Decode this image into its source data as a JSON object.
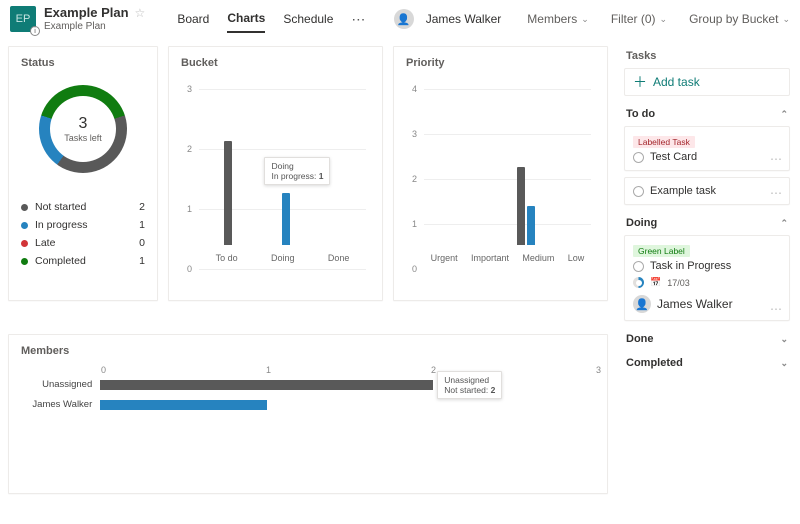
{
  "header": {
    "plan_initials": "EP",
    "plan_title": "Example Plan",
    "plan_subtitle": "Example Plan",
    "tabs": {
      "board": "Board",
      "charts": "Charts",
      "schedule": "Schedule"
    },
    "user": "James Walker",
    "members_cmd": "Members",
    "filter_cmd": "Filter (0)",
    "group_cmd": "Group by Bucket"
  },
  "chart_data": {
    "status": {
      "type": "donut",
      "center_value": 3,
      "center_label": "Tasks left",
      "legend": [
        {
          "label": "Not started",
          "value": 2,
          "color": "#595959"
        },
        {
          "label": "In progress",
          "value": 1,
          "color": "#2683bf"
        },
        {
          "label": "Late",
          "value": 0,
          "color": "#d13438"
        },
        {
          "label": "Completed",
          "value": 1,
          "color": "#107c10"
        }
      ]
    },
    "bucket": {
      "type": "bar",
      "title": "Bucket",
      "categories": [
        "To do",
        "Doing",
        "Done"
      ],
      "yticks": [
        0,
        1,
        2,
        3
      ],
      "ylim": [
        0,
        3
      ],
      "series": [
        {
          "name": "Not started",
          "color": "#595959",
          "values": [
            2,
            0,
            0
          ]
        },
        {
          "name": "In progress",
          "color": "#2683bf",
          "values": [
            0,
            1,
            0
          ]
        }
      ],
      "tooltip": {
        "category": "Doing",
        "series": "In progress",
        "value": 1
      }
    },
    "priority": {
      "type": "bar",
      "title": "Priority",
      "categories": [
        "Urgent",
        "Important",
        "Medium",
        "Low"
      ],
      "yticks": [
        0,
        1,
        2,
        3,
        4
      ],
      "ylim": [
        0,
        4
      ],
      "series": [
        {
          "name": "Not started",
          "color": "#595959",
          "values": [
            0,
            0,
            2,
            0
          ]
        },
        {
          "name": "In progress",
          "color": "#2683bf",
          "values": [
            0,
            0,
            1,
            0
          ]
        }
      ]
    },
    "members": {
      "type": "bar",
      "title": "Members",
      "orientation": "horizontal",
      "xticks": [
        0,
        1,
        2,
        3
      ],
      "xlim": [
        0,
        3
      ],
      "categories": [
        "Unassigned",
        "James Walker"
      ],
      "series": [
        {
          "name": "Not started",
          "color": "#595959",
          "values": [
            2,
            0
          ]
        },
        {
          "name": "In progress",
          "color": "#2683bf",
          "values": [
            0,
            1
          ]
        }
      ],
      "tooltip": {
        "category": "Unassigned",
        "series": "Not started",
        "value": 2
      }
    }
  },
  "panels": {
    "status_title": "Status",
    "bucket_title": "Bucket",
    "priority_title": "Priority",
    "members_title": "Members"
  },
  "side": {
    "tasks_title": "Tasks",
    "add_task": "Add task",
    "sections": {
      "todo": "To do",
      "doing": "Doing",
      "done": "Done",
      "completed": "Completed"
    },
    "todo_cards": [
      {
        "label": "Labelled Task",
        "name": "Test Card"
      },
      {
        "name": "Example task"
      }
    ],
    "doing_card": {
      "label": "Green Label",
      "name": "Task in Progress",
      "date": "17/03",
      "assignee": "James Walker"
    }
  }
}
